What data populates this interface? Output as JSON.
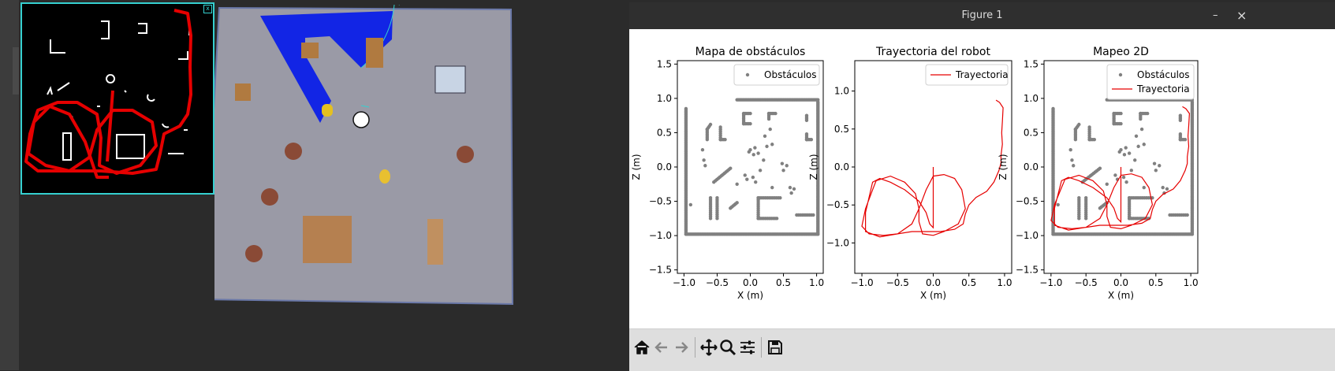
{
  "figure_window": {
    "title": "Figure 1",
    "minimize_glyph": "–",
    "close_glyph": "×"
  },
  "toolbar": {
    "buttons": [
      {
        "name": "home-icon",
        "tooltip": "Reset original view"
      },
      {
        "name": "back-arrow-icon",
        "tooltip": "Back to previous view"
      },
      {
        "name": "forward-arrow-icon",
        "tooltip": "Forward to next view"
      },
      {
        "name": "pan-icon",
        "tooltip": "Pan axes"
      },
      {
        "name": "zoom-icon",
        "tooltip": "Zoom to rectangle"
      },
      {
        "name": "configure-subplots-icon",
        "tooltip": "Configure subplots"
      },
      {
        "name": "save-icon",
        "tooltip": "Save the figure"
      }
    ]
  },
  "simulator": {
    "minimap_close_glyph": "x",
    "colors": {
      "floor": "#9a9aa6",
      "lidar": "#0b1fe8",
      "trajectory": "#e60000",
      "minimap_border": "#35d0d0"
    }
  },
  "chart_data": [
    {
      "type": "scatter",
      "title": "Mapa de obstáculos",
      "xlabel": "X (m)",
      "ylabel": "Z (m)",
      "xlim": [
        -1.1,
        1.1
      ],
      "ylim": [
        -1.55,
        1.55
      ],
      "xticks": [
        -1.0,
        -0.5,
        0.0,
        0.5,
        1.0
      ],
      "xtick_labels": [
        "−1.0",
        "−0.5",
        "0.0",
        "0.5",
        "1.0"
      ],
      "yticks": [
        -1.5,
        -1.0,
        -0.5,
        0.0,
        0.5,
        1.0,
        1.5
      ],
      "ytick_labels": [
        "−1.5",
        "−1.0",
        "−0.5",
        "0.0",
        "0.5",
        "1.0",
        "1.5"
      ],
      "legend": {
        "position": "top-right",
        "entries": [
          "Obstáculos"
        ]
      },
      "series": [
        {
          "name": "Obstáculos",
          "color": "#808080",
          "kind": "points"
        }
      ]
    },
    {
      "type": "line",
      "title": "Trayectoria del robot",
      "xlabel": "X (m)",
      "ylabel": "Z (m)",
      "xlim": [
        -1.1,
        1.1
      ],
      "ylim": [
        -1.4,
        1.4
      ],
      "xticks": [
        -1.0,
        -0.5,
        0.0,
        0.5,
        1.0
      ],
      "xtick_labels": [
        "−1.0",
        "−0.5",
        "0.0",
        "0.5",
        "1.0"
      ],
      "yticks": [
        -1.0,
        -0.5,
        0.0,
        0.5,
        1.0
      ],
      "ytick_labels": [
        "−1.0",
        "−0.5",
        "0.0",
        "0.5",
        "1.0"
      ],
      "legend": {
        "position": "top-right",
        "entries": [
          "Trayectoria"
        ]
      },
      "series": [
        {
          "name": "Trayectoria",
          "color": "#e60000",
          "kind": "line"
        }
      ]
    },
    {
      "type": "scatter",
      "title": "Mapeo 2D",
      "xlabel": "X (m)",
      "ylabel": "Z (m)",
      "xlim": [
        -1.1,
        1.1
      ],
      "ylim": [
        -1.55,
        1.55
      ],
      "xticks": [
        -1.0,
        -0.5,
        0.0,
        0.5,
        1.0
      ],
      "xtick_labels": [
        "−1.0",
        "−0.5",
        "0.0",
        "0.5",
        "1.0"
      ],
      "yticks": [
        -1.5,
        -1.0,
        -0.5,
        0.0,
        0.5,
        1.0,
        1.5
      ],
      "ytick_labels": [
        "−1.5",
        "−1.0",
        "−0.5",
        "0.0",
        "0.5",
        "1.0",
        "1.5"
      ],
      "legend": {
        "position": "top-right",
        "entries": [
          "Obstáculos",
          "Trayectoria"
        ]
      },
      "series": [
        {
          "name": "Obstáculos",
          "color": "#808080",
          "kind": "points"
        },
        {
          "name": "Trayectoria",
          "color": "#e60000",
          "kind": "line"
        }
      ]
    }
  ],
  "obstacle_points": {
    "walls": [
      [
        [
          -0.97,
          0.85
        ],
        [
          -0.97,
          -0.98
        ]
      ],
      [
        [
          -0.97,
          -0.98
        ],
        [
          1.02,
          -0.98
        ]
      ],
      [
        [
          1.02,
          -0.98
        ],
        [
          1.02,
          0.95
        ]
      ],
      [
        [
          -0.2,
          0.98
        ],
        [
          1.02,
          0.98
        ]
      ]
    ],
    "shapes": [
      [
        [
          -0.65,
          0.55
        ],
        [
          -0.65,
          0.4
        ]
      ],
      [
        [
          -0.65,
          0.55
        ],
        [
          -0.6,
          0.62
        ]
      ],
      [
        [
          -0.45,
          0.58
        ],
        [
          -0.45,
          0.4
        ]
      ],
      [
        [
          -0.45,
          0.4
        ],
        [
          -0.38,
          0.4
        ]
      ],
      [
        [
          -0.1,
          0.78
        ],
        [
          -0.1,
          0.63
        ]
      ],
      [
        [
          -0.1,
          0.78
        ],
        [
          0.0,
          0.78
        ]
      ],
      [
        [
          -0.1,
          0.63
        ],
        [
          0.0,
          0.63
        ]
      ],
      [
        [
          0.28,
          0.78
        ],
        [
          0.38,
          0.78
        ]
      ],
      [
        [
          0.28,
          0.78
        ],
        [
          0.28,
          0.7
        ]
      ],
      [
        [
          0.85,
          0.75
        ],
        [
          0.85,
          0.68
        ]
      ],
      [
        [
          0.85,
          0.4
        ],
        [
          0.92,
          0.4
        ]
      ],
      [
        [
          0.85,
          0.4
        ],
        [
          0.85,
          0.48
        ]
      ],
      [
        [
          -0.6,
          -0.45
        ],
        [
          -0.6,
          -0.75
        ]
      ],
      [
        [
          -0.5,
          -0.45
        ],
        [
          -0.5,
          -0.75
        ]
      ],
      [
        [
          0.12,
          -0.45
        ],
        [
          0.45,
          -0.45
        ]
      ],
      [
        [
          0.12,
          -0.45
        ],
        [
          0.12,
          -0.75
        ]
      ],
      [
        [
          0.12,
          -0.75
        ],
        [
          0.4,
          -0.75
        ]
      ],
      [
        [
          -0.55,
          -0.22
        ],
        [
          -0.3,
          -0.02
        ]
      ],
      [
        [
          0.7,
          -0.7
        ],
        [
          0.95,
          -0.7
        ]
      ],
      [
        [
          -0.3,
          -0.6
        ],
        [
          -0.2,
          -0.52
        ]
      ]
    ],
    "blobs": [
      [
        -0.72,
        0.25
      ],
      [
        -0.7,
        0.1
      ],
      [
        -0.68,
        0.02
      ],
      [
        -0.02,
        0.22
      ],
      [
        0.0,
        0.25
      ],
      [
        0.05,
        0.18
      ],
      [
        0.07,
        0.28
      ],
      [
        -0.08,
        -0.12
      ],
      [
        -0.05,
        -0.18
      ],
      [
        0.04,
        -0.15
      ],
      [
        0.08,
        -0.22
      ],
      [
        0.48,
        0.05
      ],
      [
        0.5,
        -0.05
      ],
      [
        0.55,
        0.02
      ],
      [
        0.6,
        -0.3
      ],
      [
        0.62,
        -0.38
      ],
      [
        0.66,
        -0.32
      ],
      [
        -0.9,
        -0.55
      ],
      [
        0.22,
        0.45
      ],
      [
        0.3,
        0.55
      ],
      [
        0.25,
        0.3
      ],
      [
        0.33,
        0.33
      ],
      [
        0.12,
        0.2
      ],
      [
        0.15,
        -0.05
      ],
      [
        0.2,
        0.1
      ],
      [
        -0.2,
        -0.25
      ],
      [
        0.33,
        -0.3
      ]
    ]
  },
  "trajectory": [
    [
      0.88,
      0.88
    ],
    [
      0.93,
      0.85
    ],
    [
      0.98,
      0.78
    ],
    [
      0.97,
      0.6
    ],
    [
      0.96,
      0.45
    ],
    [
      0.97,
      0.3
    ],
    [
      0.95,
      0.15
    ],
    [
      0.95,
      0.05
    ],
    [
      0.92,
      -0.05
    ],
    [
      0.85,
      -0.2
    ],
    [
      0.75,
      -0.32
    ],
    [
      0.6,
      -0.4
    ],
    [
      0.5,
      -0.5
    ],
    [
      0.45,
      -0.62
    ],
    [
      0.42,
      -0.75
    ],
    [
      0.3,
      -0.82
    ],
    [
      0.1,
      -0.85
    ],
    [
      -0.1,
      -0.85
    ],
    [
      -0.3,
      -0.85
    ],
    [
      -0.5,
      -0.88
    ],
    [
      -0.7,
      -0.9
    ],
    [
      -0.9,
      -0.88
    ],
    [
      -1.0,
      -0.78
    ],
    [
      -0.95,
      -0.55
    ],
    [
      -0.85,
      -0.3
    ],
    [
      -0.8,
      -0.18
    ],
    [
      -0.6,
      -0.12
    ],
    [
      -0.4,
      -0.2
    ],
    [
      -0.25,
      -0.35
    ],
    [
      -0.2,
      -0.55
    ],
    [
      -0.2,
      -0.72
    ],
    [
      -0.15,
      -0.88
    ],
    [
      0.0,
      -0.9
    ],
    [
      0.15,
      -0.85
    ],
    [
      0.35,
      -0.75
    ],
    [
      0.45,
      -0.55
    ],
    [
      0.4,
      -0.3
    ],
    [
      0.3,
      -0.15
    ],
    [
      0.15,
      -0.1
    ],
    [
      0.0,
      -0.12
    ],
    [
      -0.1,
      -0.3
    ],
    [
      -0.2,
      -0.55
    ],
    [
      -0.3,
      -0.75
    ],
    [
      -0.5,
      -0.88
    ],
    [
      -0.75,
      -0.92
    ],
    [
      -0.95,
      -0.85
    ],
    [
      -0.95,
      -0.6
    ],
    [
      -0.85,
      -0.2
    ],
    [
      -0.75,
      -0.15
    ],
    [
      -0.6,
      -0.2
    ],
    [
      -0.4,
      -0.3
    ],
    [
      -0.2,
      -0.45
    ],
    [
      -0.1,
      -0.6
    ],
    [
      -0.05,
      -0.75
    ],
    [
      0.0,
      -0.8
    ],
    [
      0.0,
      -0.6
    ],
    [
      0.0,
      -0.3
    ],
    [
      0.0,
      0.0
    ]
  ]
}
